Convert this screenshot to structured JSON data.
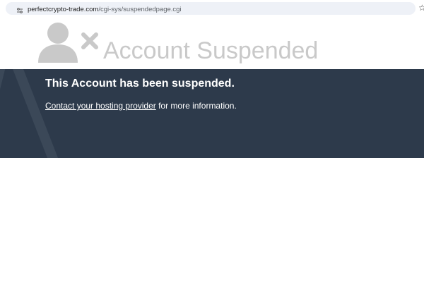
{
  "browser": {
    "back_glyph": "‹",
    "url_domain": "perfectcrypto-trade.com",
    "url_path": "/cgi-sys/suspendedpage.cgi",
    "bookmark_icon": "star-icon",
    "site_info_icon": "site-settings-icon"
  },
  "header": {
    "icon": "user-x-icon",
    "title": "Account Suspended",
    "title_color": "#c9c9c9"
  },
  "banner": {
    "background": "#2d3a4b",
    "heading": "This Account has been suspended.",
    "link_text": "Contact your hosting provider",
    "tail_text": " for more information."
  }
}
